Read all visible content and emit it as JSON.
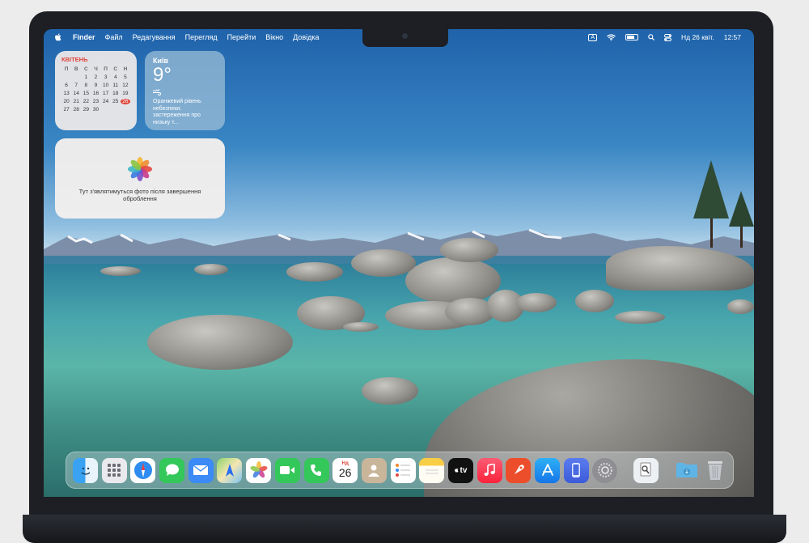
{
  "menubar": {
    "app": "Finder",
    "items": [
      "Файл",
      "Редагування",
      "Перегляд",
      "Перейти",
      "Вікно",
      "Довідка"
    ],
    "input_source": "A",
    "date": "Нд 26 квіт.",
    "time": "12:57"
  },
  "calendar_widget": {
    "month": "КВІТЕНЬ",
    "weekdays": [
      "П",
      "В",
      "С",
      "Ч",
      "П",
      "С",
      "Н"
    ],
    "rows": [
      [
        "",
        "",
        "1",
        "2",
        "3",
        "4",
        "5"
      ],
      [
        "6",
        "7",
        "8",
        "9",
        "10",
        "11",
        "12"
      ],
      [
        "13",
        "14",
        "15",
        "16",
        "17",
        "18",
        "19"
      ],
      [
        "20",
        "21",
        "22",
        "23",
        "24",
        "25",
        "26"
      ],
      [
        "27",
        "28",
        "29",
        "30",
        "",
        "",
        ""
      ]
    ],
    "today": "26"
  },
  "weather_widget": {
    "city": "Київ",
    "temperature": "9°",
    "alert": "Оранжевий рівень небезпеки: застереження про низьку т..."
  },
  "photos_widget": {
    "message": "Тут з'являтимуться фото після завершення оброблення"
  },
  "dock": {
    "calendar_day": "26",
    "calendar_month": "Нд",
    "apps": [
      "Finder",
      "Launchpad",
      "Safari",
      "Messages",
      "Mail",
      "Maps",
      "Photos",
      "FaceTime",
      "Phone",
      "Calendar",
      "Contacts",
      "Reminders",
      "Notes",
      "TV",
      "Music",
      "Keynote",
      "App Store",
      "iPhone Mirroring",
      "System Settings",
      "Preview",
      "Downloads",
      "Trash"
    ],
    "tv_label": "tv"
  },
  "colors": {
    "calendar_accent": "#e0453a",
    "menubar_text": "#ffffff"
  }
}
